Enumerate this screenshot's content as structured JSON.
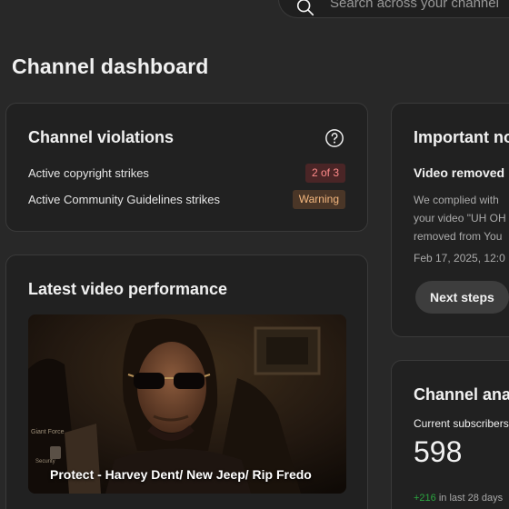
{
  "search": {
    "placeholder": "Search across your channel"
  },
  "page_title": "Channel dashboard",
  "violations": {
    "title": "Channel violations",
    "rows": [
      {
        "label": "Active copyright strikes",
        "badge": "2 of 3"
      },
      {
        "label": "Active Community Guidelines strikes",
        "badge": "Warning"
      }
    ]
  },
  "latest_video": {
    "title": "Latest video performance",
    "video_title": "Protect - Harvey Dent/ New Jeep/ Rip Fredo",
    "watermark_line1": "Giant Force",
    "watermark_line2": "Security"
  },
  "notices": {
    "title": "Important notices",
    "heading": "Video removed",
    "body_lines": [
      "We complied with",
      "your video \"UH OH",
      "removed from You"
    ],
    "date": "Feb 17, 2025, 12:0",
    "button": "Next steps"
  },
  "analytics": {
    "title": "Channel analytics",
    "current_label": "Current subscribers",
    "current_value": "598",
    "delta": "+216",
    "delta_suffix": " in last 28 days"
  },
  "colors": {
    "background": "#282828",
    "card": "#212121",
    "strike_badge": "#ff8a8a",
    "warning_badge": "#f4b77e",
    "positive_change": "#2ba640"
  }
}
